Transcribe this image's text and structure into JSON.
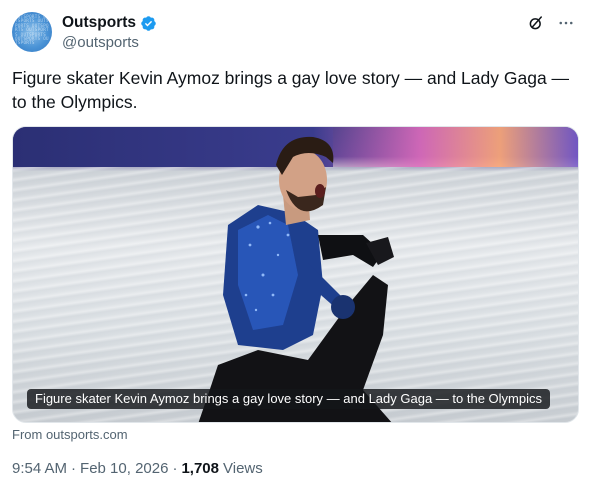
{
  "author": {
    "display_name": "Outsports",
    "handle": "@outsports",
    "verified": true,
    "avatar_text": "OUTSPORTS OUTSPORTS OUTSPORTS OUTSPORTS OUTSPORTS OUTSPORTS OUTSPORTS OUTSPORTS"
  },
  "actions": {
    "grok_icon": "grok-icon",
    "more_icon": "more-icon"
  },
  "tweet": {
    "text": "Figure skater Kevin Aymoz brings a gay love story — and Lady Gaga — to the Olympics."
  },
  "link_card": {
    "image_subject": "skater-photo",
    "caption": "Figure skater Kevin Aymoz brings a gay love story — and Lady Gaga — to the Olympics",
    "source": "From outsports.com"
  },
  "meta": {
    "time": "9:54 AM",
    "date": "Feb 10, 2026",
    "views_count": "1,708",
    "views_label": "Views"
  },
  "colors": {
    "text_primary": "#0f1419",
    "text_secondary": "#536471",
    "verified_blue": "#1d9bf0"
  }
}
